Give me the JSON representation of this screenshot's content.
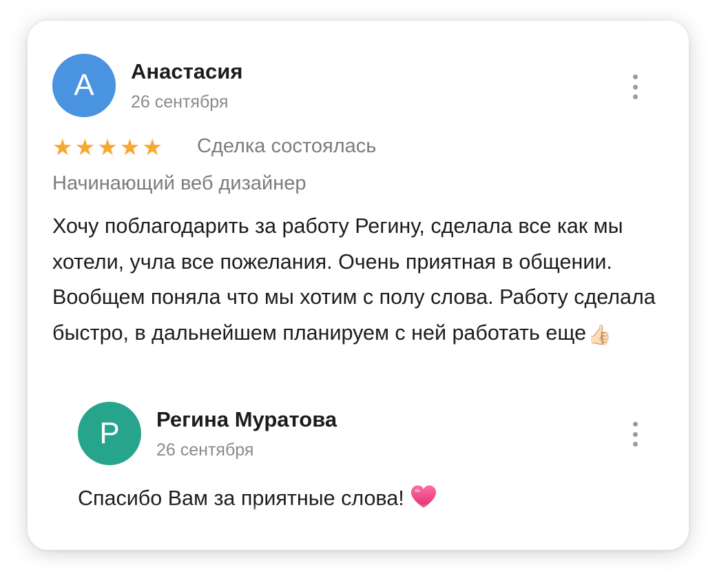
{
  "review": {
    "author_initial": "А",
    "author_name": "Анастасия",
    "date": "26 сентября",
    "rating": 5,
    "stars": [
      "★",
      "★",
      "★",
      "★",
      "★"
    ],
    "deal_status": "Сделка состоялась",
    "author_role": "Начинающий веб дизайнер",
    "text": "Хочу поблагодарить за работу Регину, сделала все как мы хотели, учла все пожелания. Очень приятная в общении. Вообщем поняла что мы хотим с полу слова. Работу сделала быстро, в дальнейшем планируем с ней работать еще",
    "text_emoji": "👍🏻"
  },
  "reply": {
    "author_initial": "Р",
    "author_name": "Регина Муратова",
    "date": "26 сентября",
    "text": "Спасибо Вам за приятные слова!",
    "emoji_icon": "heart-icon"
  },
  "colors": {
    "avatar_reviewer": "#4a93e0",
    "avatar_replier": "#27a48c",
    "star": "#f7a830",
    "heart": "#e8377a",
    "muted_text": "#7c7c7c"
  }
}
